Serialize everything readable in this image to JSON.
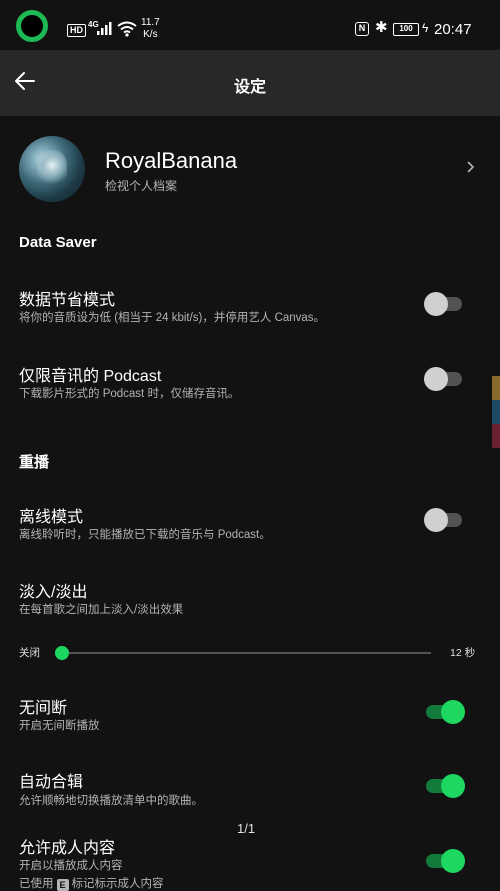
{
  "status_bar": {
    "hd": "HD",
    "network": "4G",
    "speed_value": "11.7",
    "speed_unit": "K/s",
    "nfc": "N",
    "battery": "100",
    "time": "20:47"
  },
  "header": {
    "title": "设定"
  },
  "profile": {
    "name": "RoyalBanana",
    "subtitle": "检视个人档案"
  },
  "sections": {
    "data_saver": "Data Saver",
    "playback": "重播"
  },
  "rows": {
    "data_saver_mode": {
      "title": "数据节省模式",
      "subtitle": "将你的音质设为低 (相当于 24 kbit/s)，并停用艺人 Canvas。",
      "enabled": false
    },
    "audio_only_podcast": {
      "title": "仅限音讯的 Podcast",
      "subtitle": "下载影片形式的 Podcast 时，仅储存音讯。",
      "enabled": false
    },
    "offline_mode": {
      "title": "离线模式",
      "subtitle": "离线聆听时，只能播放已下载的音乐与 Podcast。",
      "enabled": false
    },
    "crossfade": {
      "title": "淡入/淡出",
      "subtitle": "在每首歌之间加上淡入/淡出效果"
    },
    "gapless": {
      "title": "无间断",
      "subtitle": "开启无间断播放",
      "enabled": true
    },
    "automix": {
      "title": "自动合辑",
      "subtitle": "允许顺畅地切换播放清单中的歌曲。",
      "enabled": true
    },
    "explicit": {
      "title": "允许成人内容",
      "subtitle": "开启以播放成人内容",
      "subtitle2_pre": "已使用",
      "badge": "E",
      "subtitle2_post": "标记标示成人内容",
      "enabled": true
    }
  },
  "crossfade_slider": {
    "min_label": "关闭",
    "max_label": "12 秒",
    "value_seconds": 0
  },
  "pager": "1/1",
  "colors": {
    "accent": "#1ed760",
    "background": "#121212",
    "header": "#282828"
  },
  "icons": {
    "back": "arrow-left-icon",
    "chevron": "chevron-right-icon"
  }
}
